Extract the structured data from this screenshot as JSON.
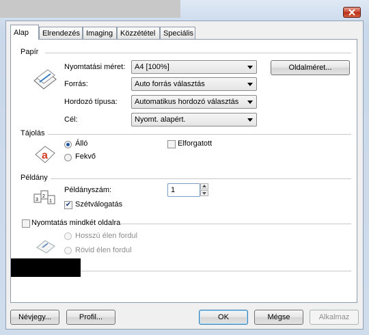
{
  "tabs": [
    {
      "label": "Alap",
      "active": true
    },
    {
      "label": "Elrendezés",
      "active": false
    },
    {
      "label": "Imaging",
      "active": false
    },
    {
      "label": "Közzététel",
      "active": false
    },
    {
      "label": "Speciális",
      "active": false
    }
  ],
  "paper": {
    "group_label": "Papír",
    "size_label": "Nyomtatási méret:",
    "size_value": "A4  [100%]",
    "page_size_button": "Oldalméret...",
    "source_label": "Forrás:",
    "source_value": "Auto forrás választás",
    "media_label": "Hordozó típusa:",
    "media_value": "Automatikus hordozó választás",
    "dest_label": "Cél:",
    "dest_value": "Nyomt. alapért."
  },
  "orientation": {
    "group_label": "Tájolás",
    "portrait": "Álló",
    "landscape": "Fekvő",
    "rotated": "Elforgatott",
    "selected": "portrait"
  },
  "copies": {
    "group_label": "Példány",
    "count_label": "Példányszám:",
    "count_value": "1",
    "collate": "Szétválogatás",
    "collate_checked": true
  },
  "duplex": {
    "label": "Nyomtatás mindkét oldalra",
    "checked": false,
    "long_edge": "Hosszú élen fordul",
    "short_edge": "Rövid élen fordul"
  },
  "footer": {
    "about": "Névjegy...",
    "profile": "Profil...",
    "ok": "OK",
    "cancel": "Mégse",
    "apply": "Alkalmaz"
  },
  "colors": {
    "accent": "#1b53a4",
    "close": "#c5442d"
  }
}
